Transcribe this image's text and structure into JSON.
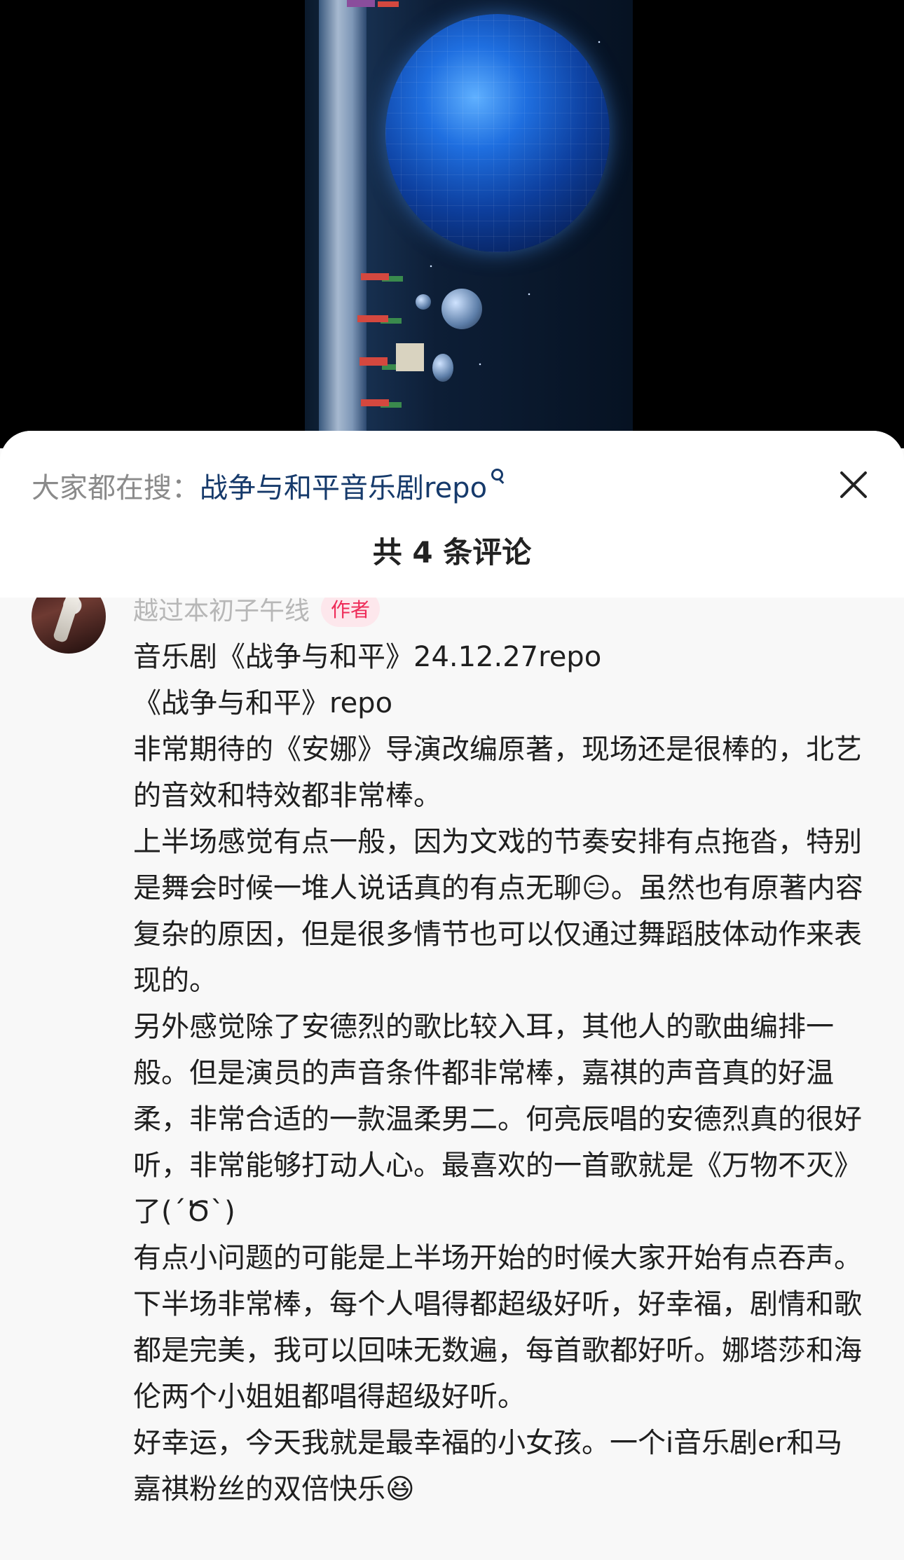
{
  "search_bar": {
    "prefix": "大家都在搜：",
    "term": "战争与和平音乐剧repo"
  },
  "header": {
    "comment_count": "共 4 条评论"
  },
  "comment": {
    "author_name": "越过本初子午线",
    "author_badge": "作者",
    "lines": [
      "音乐剧《战争与和平》24.12.27repo",
      "《战争与和平》repo",
      "非常期待的《安娜》导演改编原著，现场还是很棒的，北艺的音效和特效都非常棒。",
      "上半场感觉有点一般，因为文戏的节奏安排有点拖沓，特别是舞会时候一堆人说话真的有点无聊😑。虽然也有原著内容复杂的原因，但是很多情节也可以仅通过舞蹈肢体动作来表现的。",
      "另外感觉除了安德烈的歌比较入耳，其他人的歌曲编排一般。但是演员的声音条件都非常棒，嘉祺的声音真的好温柔，非常合适的一款温柔男二。何亮辰唱的安德烈真的很好听，非常能够打动人心。最喜欢的一首歌就是《万物不灭》了(´Ծ`)",
      "有点小问题的可能是上半场开始的时候大家开始有点吞声。",
      "下半场非常棒，每个人唱得都超级好听，好幸福，剧情和歌都是完美，我可以回味无数遍，每首歌都好听。娜塔莎和海伦两个小姐姐都唱得超级好听。",
      "好幸运，今天我就是最幸福的小女孩。一个i音乐剧er和马嘉祺粉丝的双倍快乐😆"
    ]
  }
}
